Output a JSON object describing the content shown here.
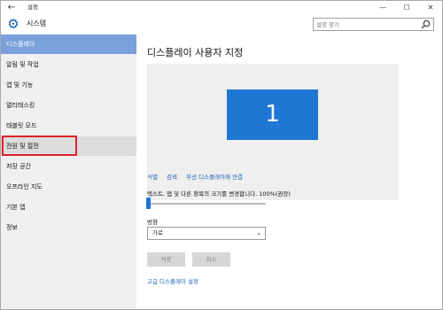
{
  "titlebar": {
    "title": "설정",
    "back": "←",
    "minimize": "—",
    "maximize": "☐",
    "close": "✕"
  },
  "header": {
    "title": "시스템",
    "icon": "gear-icon",
    "search_placeholder": "설정 찾기"
  },
  "sidebar": {
    "items": [
      {
        "label": "디스플레이",
        "state": "active"
      },
      {
        "label": "알림 및 작업"
      },
      {
        "label": "앱 및 기능"
      },
      {
        "label": "멀티태스킹"
      },
      {
        "label": "태블릿 모드"
      },
      {
        "label": "전원 및 절전",
        "state": "hover",
        "highlighted": true
      },
      {
        "label": "저장 공간"
      },
      {
        "label": "오프라인 지도"
      },
      {
        "label": "기본 앱"
      },
      {
        "label": "정보"
      }
    ]
  },
  "main": {
    "title": "디스플레이 사용자 지정",
    "monitor_number": "1",
    "links": [
      "식별",
      "검색",
      "무선 디스플레이에 연결"
    ],
    "scale_label": "텍스트, 앱 및 다른 항목의 크기를 변경합니다. 100%(권장)",
    "scale_value_fraction": 0.0,
    "orientation_label": "방향",
    "orientation_value": "가로",
    "apply_label": "적용",
    "cancel_label": "취소",
    "advanced_link": "고급 디스플레이 설정"
  },
  "colors": {
    "accent": "#1e77d2",
    "sidebar_active": "#7aa1dc",
    "highlight_border": "#e0202a"
  }
}
